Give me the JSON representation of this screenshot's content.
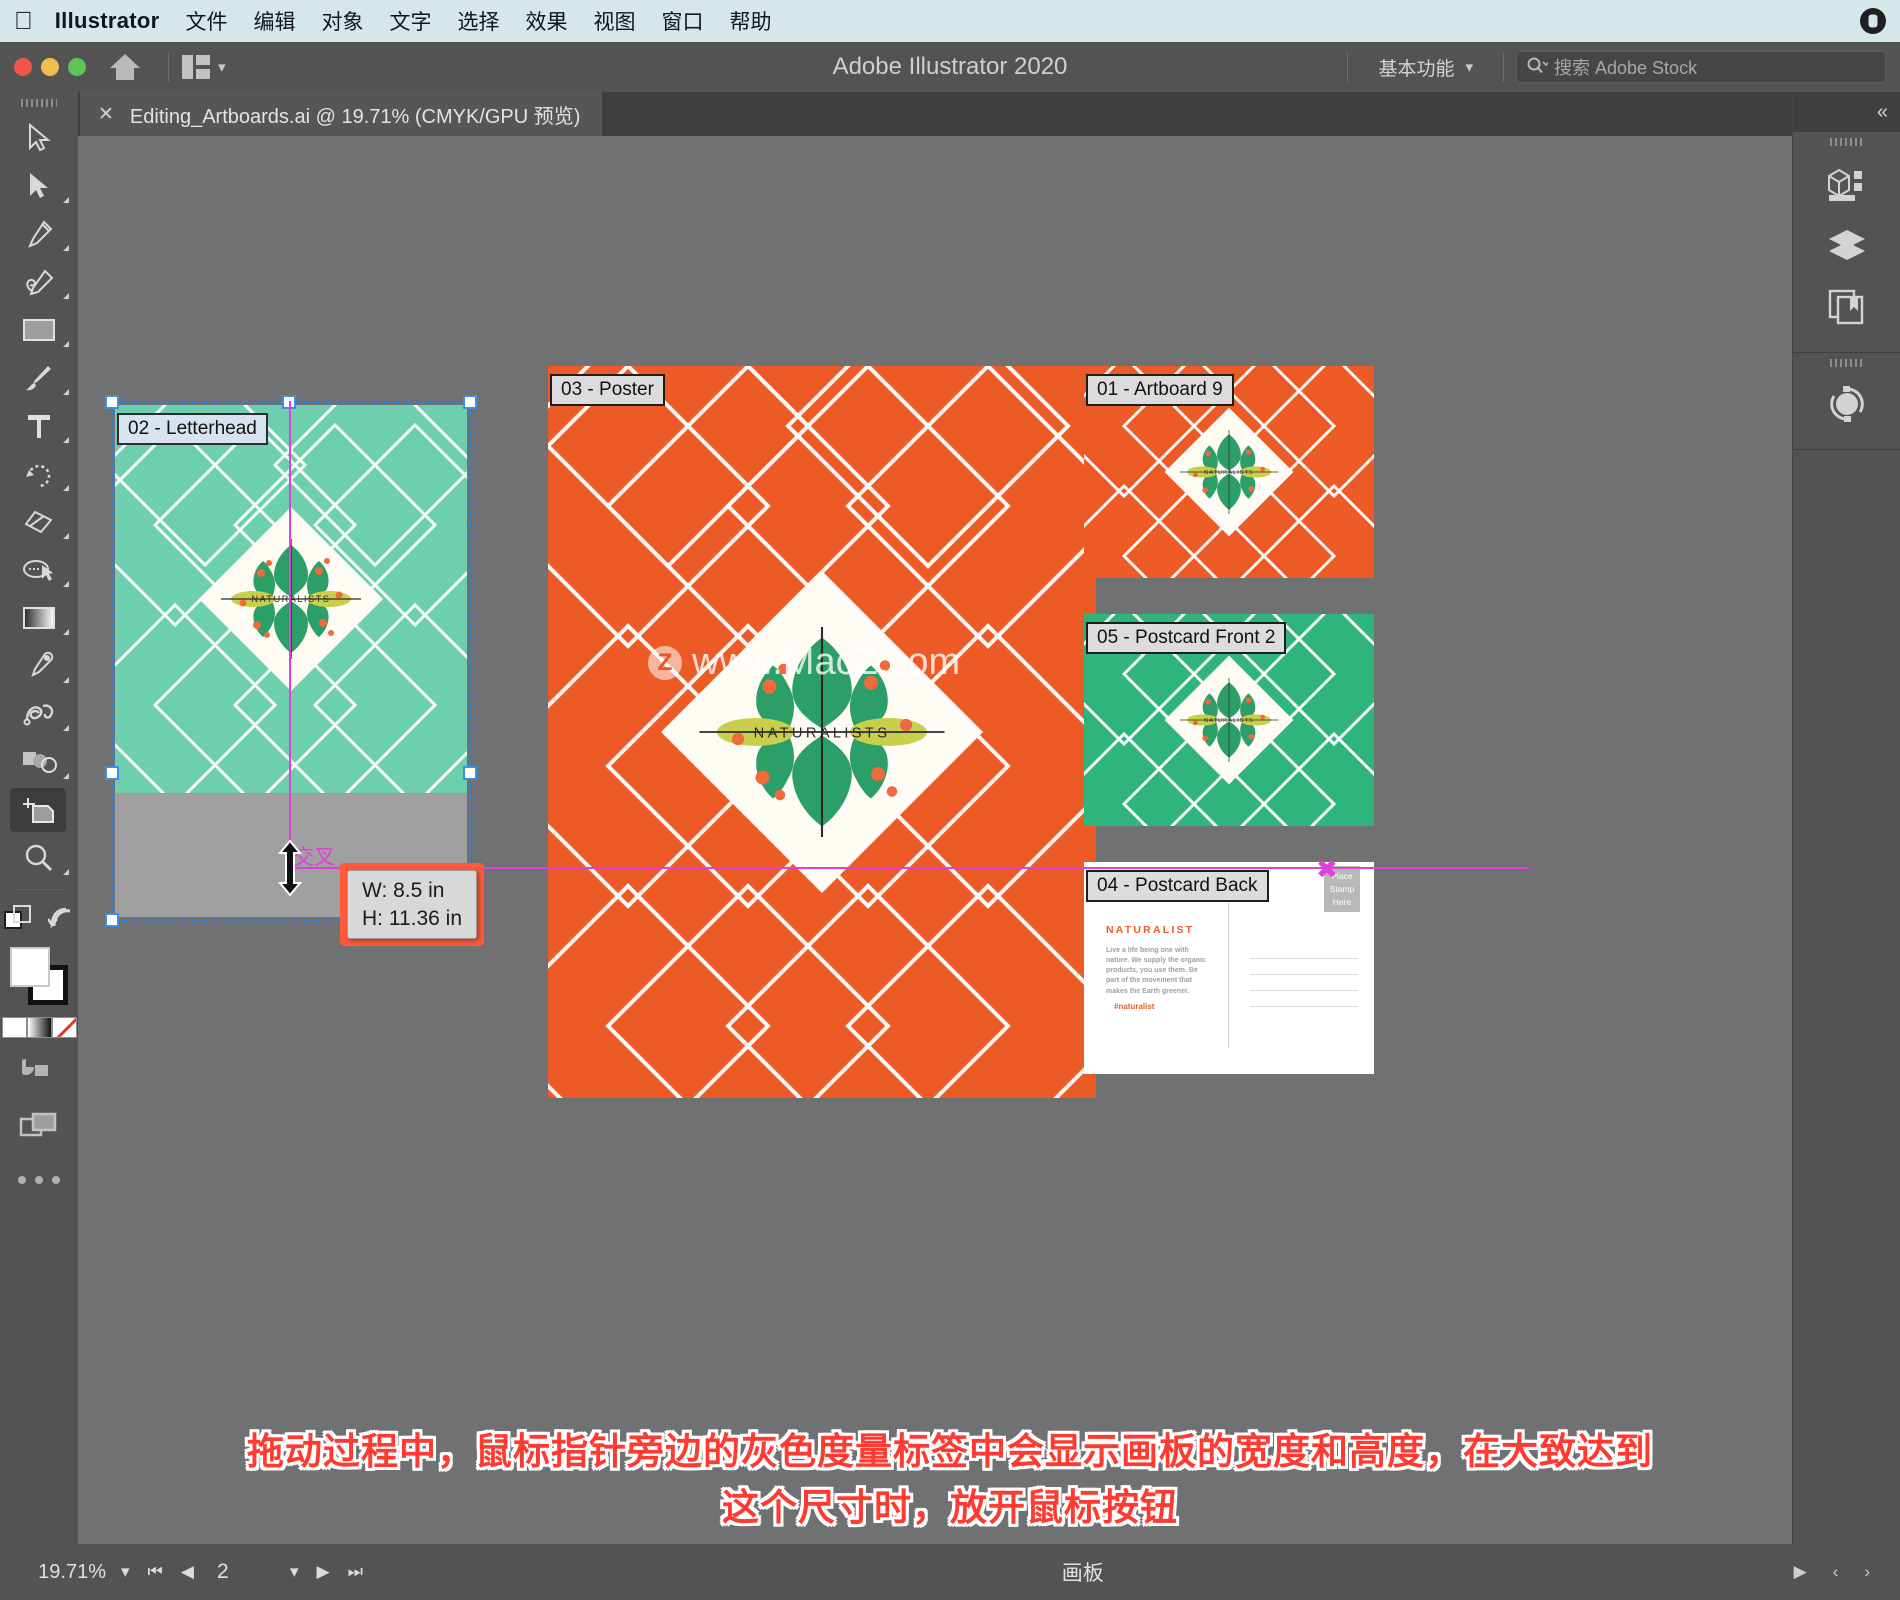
{
  "menubar": {
    "apple_icon": "apple-logo",
    "app_name": "Illustrator",
    "items": [
      "文件",
      "编辑",
      "对象",
      "文字",
      "选择",
      "效果",
      "视图",
      "窗口",
      "帮助"
    ],
    "siri_icon": "siri-icon"
  },
  "titlebar": {
    "title": "Adobe Illustrator 2020",
    "workspace": "基本功能",
    "search_placeholder": "搜索 Adobe Stock",
    "home_icon": "home-icon",
    "layout_icon": "arrange-documents-icon",
    "search_icon": "search-icon"
  },
  "tab": {
    "close": "✕",
    "label": "Editing_Artboards.ai @ 19.71% (CMYK/GPU 预览)"
  },
  "toolbar": {
    "tools": [
      {
        "name": "selection-tool",
        "icon": "arrow-cursor-icon",
        "active": false
      },
      {
        "name": "direct-selection-tool",
        "icon": "solid-arrow-icon",
        "active": false
      },
      {
        "name": "pen-tool",
        "icon": "pen-icon",
        "active": false
      },
      {
        "name": "curvature-tool",
        "icon": "curvature-icon",
        "active": false
      },
      {
        "name": "rectangle-tool",
        "icon": "rectangle-icon",
        "active": false
      },
      {
        "name": "paintbrush-tool",
        "icon": "paintbrush-icon",
        "active": false
      },
      {
        "name": "type-tool",
        "icon": "type-T-icon",
        "active": false
      },
      {
        "name": "rotate-tool",
        "icon": "rotate-icon",
        "active": false
      },
      {
        "name": "eraser-tool",
        "icon": "eraser-icon",
        "active": false
      },
      {
        "name": "shape-builder-tool",
        "icon": "shape-builder-icon",
        "active": false
      },
      {
        "name": "gradient-tool",
        "icon": "gradient-icon",
        "active": false
      },
      {
        "name": "eyedropper-tool",
        "icon": "eyedropper-icon",
        "active": false
      },
      {
        "name": "blend-tool",
        "icon": "blend-icon",
        "active": false
      },
      {
        "name": "symbol-sprayer-tool",
        "icon": "symbol-sprayer-icon",
        "active": false
      },
      {
        "name": "artboard-tool",
        "icon": "artboard-icon",
        "active": true
      },
      {
        "name": "zoom-tool",
        "icon": "magnifier-icon",
        "active": false
      }
    ],
    "extras": {
      "change_screen_mode_icon": "screen-mode-icon",
      "edit_toolbar_icon": "ellipsis-icon"
    }
  },
  "right_panel": {
    "collapse_icon": "collapse-panels-icon",
    "icons": [
      {
        "name": "properties-panel-icon"
      },
      {
        "name": "layers-panel-icon"
      },
      {
        "name": "libraries-panel-icon"
      },
      {
        "name": "color-themes-panel-icon"
      }
    ]
  },
  "canvas": {
    "artboards": [
      {
        "id": "02",
        "label": "02 - Letterhead",
        "title": "Letterhead",
        "bg": "#6ecfae",
        "selected": true
      },
      {
        "id": "03",
        "label": "03 - Poster",
        "title": "Poster",
        "bg": "#ec5b26",
        "selected": false
      },
      {
        "id": "01",
        "label": "01 - Artboard 9",
        "title": "Artboard 9",
        "bg": "#ec5b26",
        "selected": false
      },
      {
        "id": "05",
        "label": "05 - Postcard Front 2",
        "title": "Postcard Front 2",
        "bg": "#2fb47c",
        "selected": false
      },
      {
        "id": "04",
        "label": "04 - Postcard Back",
        "title": "Postcard Back",
        "bg": "#ffffff",
        "selected": false
      }
    ],
    "logo_text": "NATURALISTS",
    "postcard": {
      "brand": "NATURALIST",
      "body": "Live a life being one with nature. We supply the organic products, you use them. Be part of the movement that makes the Earth greener.",
      "handle": "#naturalist",
      "stamp": "Place\nStamp\nHere",
      "stamp_line1": "Place",
      "stamp_line2": "Stamp",
      "stamp_line3": "Here"
    },
    "smart_guide_label": "交叉",
    "measurement": {
      "width": "W: 8.5 in",
      "height": "H: 11.36 in"
    },
    "watermark": "www.MacZ.com",
    "watermark_badge": "Z"
  },
  "statusbar": {
    "zoom": "19.71%",
    "zoom_chevron": "chevron-down-icon",
    "first_icon": "first-artboard-icon",
    "prev_icon": "previous-artboard-icon",
    "page": "2",
    "page_chevron": "chevron-down-icon",
    "next_icon": "next-artboard-icon",
    "last_icon": "last-artboard-icon",
    "mode": "画板",
    "mode_arrow": "play-arrow-icon",
    "end_left": "‹",
    "end_right": "›"
  },
  "annotation": {
    "line1": "拖动过程中，鼠标指针旁边的灰色度量标签中会显示画板的宽度和高度，在大致达到",
    "line2": "这个尺寸时，放开鼠标按钮"
  },
  "colors": {
    "menubar_bg": "#d5e7ea",
    "chrome_bg": "#535353",
    "canvas_bg": "#6f7173",
    "teal": "#6ecfae",
    "orange": "#ec5b26",
    "green": "#2fb47c",
    "selection_blue": "#2f7fe0",
    "magenta_guide": "#e03fd8",
    "annotation_red": "#ff3a30"
  }
}
